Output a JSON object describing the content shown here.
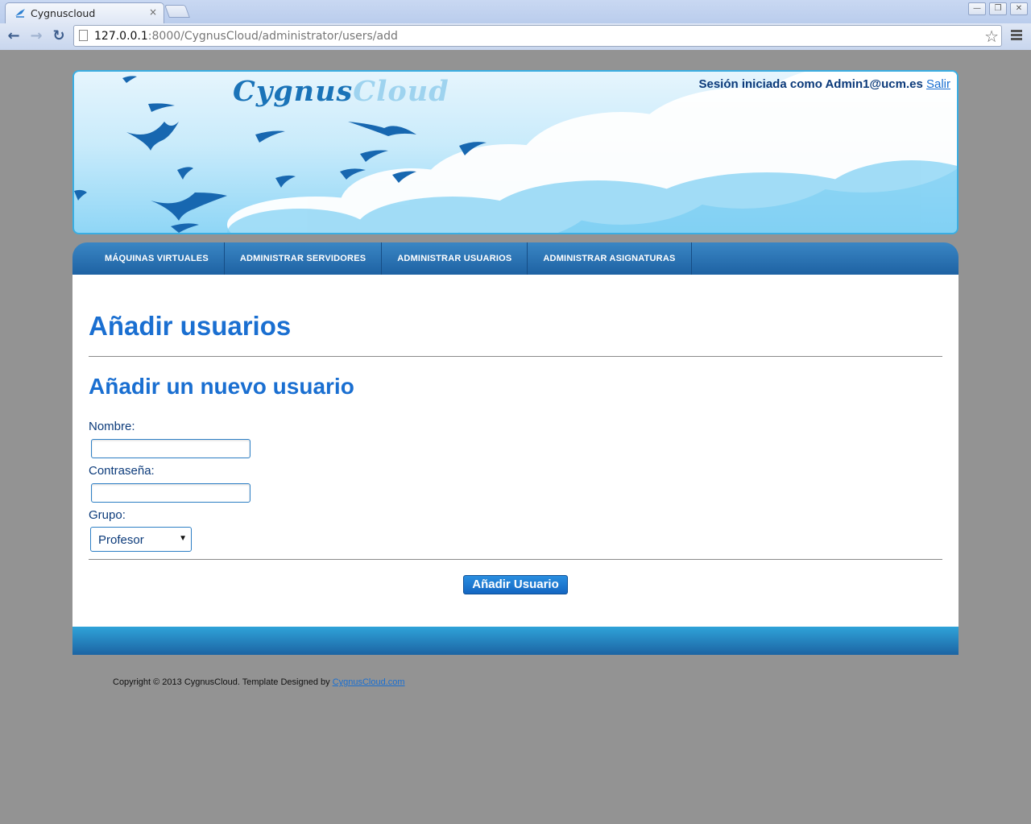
{
  "browser": {
    "tab_title": "Cygnuscloud",
    "tab_close": "×",
    "url_host": "127.0.0.1",
    "url_rest": ":8000/CygnusCloud/administrator/users/add",
    "win_min": "—",
    "win_max": "❐",
    "win_close": "✕",
    "back": "←",
    "forward": "→",
    "reload": "↻",
    "star": "☆",
    "icons": [
      "favicon-icon",
      "back-icon",
      "forward-icon",
      "reload-icon",
      "page-icon",
      "star-icon",
      "menu-icon"
    ]
  },
  "header": {
    "logo_a": "Cygnus",
    "logo_b": "Cloud",
    "session_text": "Sesión iniciada como Admin1@ucm.es",
    "logout_label": "Salir"
  },
  "menu": {
    "items": [
      {
        "label": "MÁQUINAS VIRTUALES"
      },
      {
        "label": "ADMINISTRAR SERVIDORES"
      },
      {
        "label": "ADMINISTRAR USUARIOS"
      },
      {
        "label": "ADMINISTRAR ASIGNATURAS"
      }
    ]
  },
  "main": {
    "title": "Añadir usuarios",
    "subtitle": "Añadir un nuevo usuario",
    "name_label": "Nombre:",
    "name_value": "",
    "password_label": "Contraseña:",
    "password_value": "",
    "group_label": "Grupo:",
    "group_value": "Profesor",
    "submit_label": "Añadir Usuario"
  },
  "footer": {
    "copyright": "Copyright © 2013 CygnusCloud. Template Designed by",
    "link": "CygnusCloud.com"
  },
  "colors": {
    "accent": "#1a6fd1",
    "menu_bar": "#1e62a3",
    "page_bg": "#939393"
  }
}
